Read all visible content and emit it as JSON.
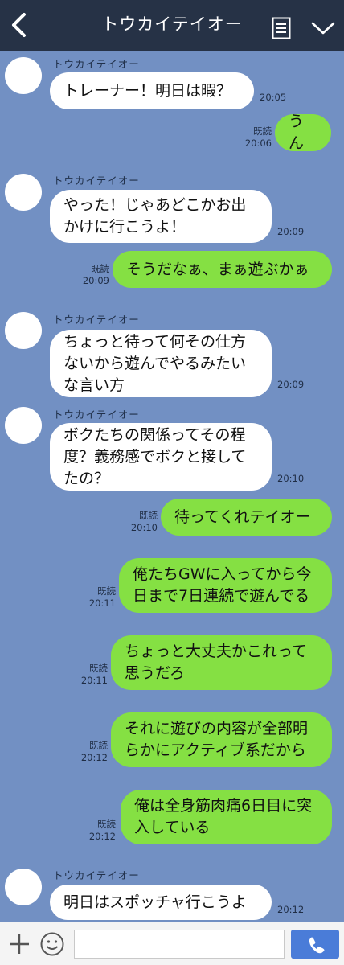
{
  "header": {
    "title": "トウカイテイオー"
  },
  "sender_name": "トウカイテイオー",
  "colors": {
    "background": "#7290c3",
    "header": "#263246",
    "incoming_bubble": "#ffffff",
    "outgoing_bubble": "#85e043",
    "send_button": "#4a7cd8"
  },
  "messages": [
    {
      "side": "in",
      "text": "トレーナー！明日は暇？",
      "time": "20:05"
    },
    {
      "side": "out",
      "text": "うん",
      "read": "既読",
      "time": "20:06"
    },
    {
      "side": "in",
      "text": "やった！じゃあどこかお出\nかけに行こうよ！",
      "time": "20:09"
    },
    {
      "side": "out",
      "text": "そうだなぁ、まぁ遊ぶかぁ",
      "read": "既読",
      "time": "20:09"
    },
    {
      "side": "in",
      "text": "ちょっと待って何その仕方\nないから遊んでやるみたい\nな言い方",
      "time": "20:09"
    },
    {
      "side": "in",
      "text": "ボクたちの関係ってその程\n度？義務感でボクと接して\nたの？",
      "time": "20:10"
    },
    {
      "side": "out",
      "text": "待ってくれテイオー",
      "read": "既読",
      "time": "20:10"
    },
    {
      "side": "out",
      "text": "俺たちGWに入ってから今\n日まで7日連続で遊んでる",
      "read": "既読",
      "time": "20:11"
    },
    {
      "side": "out",
      "text": "ちょっと大丈夫かこれって\n思うだろ",
      "read": "既読",
      "time": "20:11"
    },
    {
      "side": "out",
      "text": "それに遊びの内容が全部明\nらかにアクティブ系だから",
      "read": "既読",
      "time": "20:12"
    },
    {
      "side": "out",
      "text": "俺は全身筋肉痛6日目に突\n入している",
      "read": "既読",
      "time": "20:12"
    },
    {
      "side": "in",
      "text": "明日はスポッチャ行こうよ",
      "time": "20:12"
    }
  ],
  "footer": {
    "input_value": "",
    "icons": [
      "plus-icon",
      "smile-icon",
      "phone-icon"
    ]
  }
}
